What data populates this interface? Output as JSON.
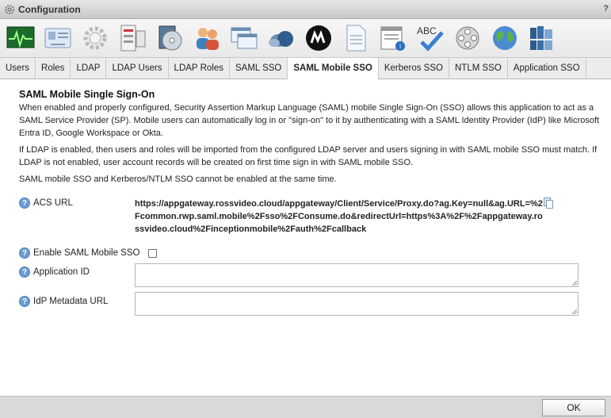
{
  "window": {
    "title": "Configuration",
    "help_glyph": "?"
  },
  "toolbar": {
    "icons": [
      "monitor-icon",
      "users-card-icon",
      "gear-settings-icon",
      "server-list-icon",
      "disc-icon",
      "people-icon",
      "windows-icon",
      "cloud-icon",
      "brand-logo-icon",
      "document-icon",
      "calendar-report-icon",
      "abc-spellcheck-icon",
      "film-reel-icon",
      "globe-icon",
      "bookshelf-icon"
    ],
    "abc_text": "ABC"
  },
  "tabs": [
    {
      "label": "Users"
    },
    {
      "label": "Roles"
    },
    {
      "label": "LDAP"
    },
    {
      "label": "LDAP Users"
    },
    {
      "label": "LDAP Roles"
    },
    {
      "label": "SAML SSO"
    },
    {
      "label": "SAML Mobile SSO",
      "active": true
    },
    {
      "label": "Kerberos SSO"
    },
    {
      "label": "NTLM SSO"
    },
    {
      "label": "Application SSO"
    }
  ],
  "section": {
    "title": "SAML Mobile Single Sign-On",
    "para1": "When enabled and properly configured, Security Assertion Markup Language (SAML) mobile Single Sign-On (SSO) allows this application to act as a SAML Service Provider (SP). Mobile users can automatically log in or \"sign-on\" to it by authenticating with a SAML Identity Provider (IdP) like Microsoft Entra ID, Google Workspace or Okta.",
    "para2": "If LDAP is enabled, then users and roles will be imported from the configured LDAP server and users signing in with SAML mobile SSO must match. If LDAP is not enabled, user account records will be created on first time sign in with SAML mobile SSO.",
    "para3": "SAML mobile SSO and Kerberos/NTLM SSO cannot be enabled at the same time."
  },
  "form": {
    "acs_label": "ACS URL",
    "acs_value": "https://appgateway.rossvideo.cloud/appgateway/Client/Service/Proxy.do?ag.Key=null&ag.URL=%2Fcommon.rwp.saml.mobile%2Fsso%2FConsume.do&redirectUrl=https%3A%2F%2Fappgateway.rossvideo.cloud%2Finceptionmobile%2Fauth%2Fcallback",
    "enable_label": "Enable SAML Mobile SSO",
    "enable_checked": false,
    "app_id_label": "Application ID",
    "app_id_value": "",
    "idp_label": "IdP Metadata URL",
    "idp_value": ""
  },
  "footer": {
    "ok_label": "OK"
  }
}
